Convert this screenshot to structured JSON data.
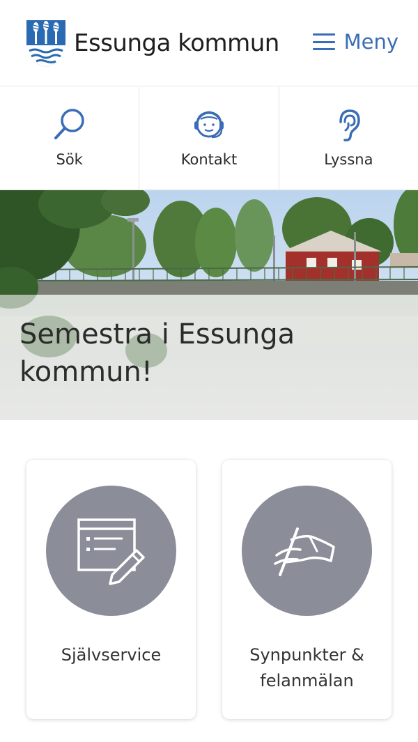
{
  "header": {
    "logo_text": "Essunga kommun",
    "logo_icon": "municipal-shield-icon",
    "menu_label": "Meny",
    "menu_icon": "hamburger-icon"
  },
  "quickbar": {
    "items": [
      {
        "label": "Sök",
        "icon": "search-icon"
      },
      {
        "label": "Kontakt",
        "icon": "headset-icon"
      },
      {
        "label": "Lyssna",
        "icon": "ear-icon"
      }
    ]
  },
  "hero": {
    "title": "Semestra i Essunga kommun!"
  },
  "cards": [
    {
      "label": "Självservice",
      "icon": "form-edit-icon"
    },
    {
      "label": "Synpunkter & felanmälan",
      "icon": "flag-hand-icon"
    }
  ],
  "colors": {
    "accent": "#3a6db5",
    "card_circle": "#8b8e99",
    "text": "#333333"
  }
}
